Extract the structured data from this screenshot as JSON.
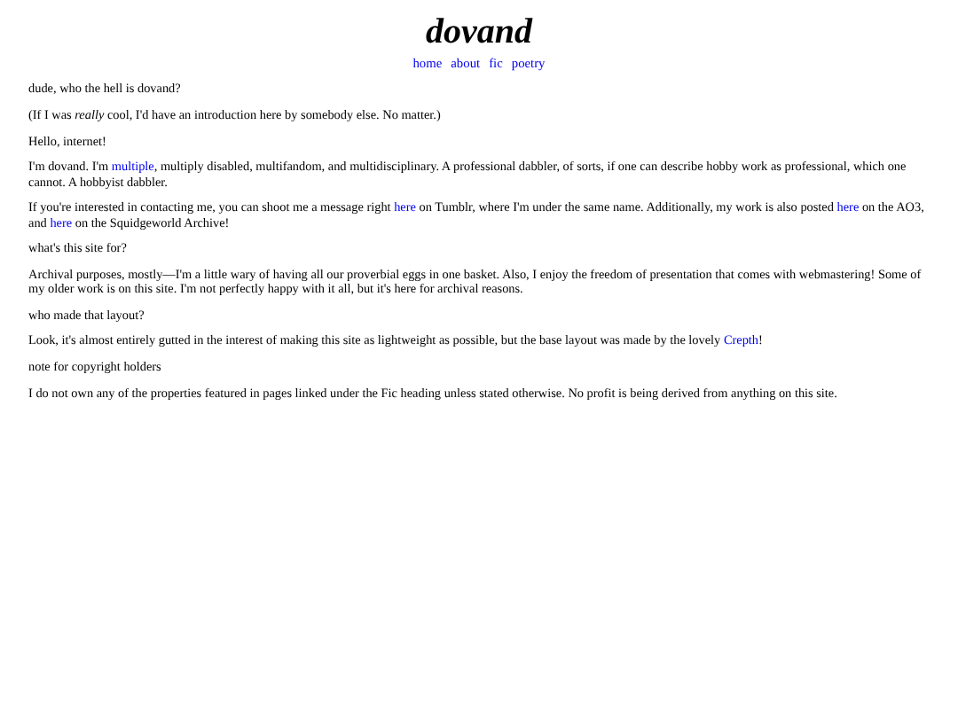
{
  "title": "dovand",
  "nav": [
    {
      "label": "home"
    },
    {
      "label": "about"
    },
    {
      "label": "fic"
    },
    {
      "label": "poetry"
    }
  ],
  "paragraphs": [
    {
      "parts": [
        {
          "kind": "text",
          "text": "dude, who the hell is dovand?"
        }
      ]
    },
    {
      "parts": [
        {
          "kind": "text",
          "text": "(If I was *really* cool, I'd have an introduction here by somebody else. No matter.)"
        }
      ]
    },
    {
      "parts": [
        {
          "kind": "text",
          "text": "Hello, internet!"
        }
      ]
    },
    {
      "parts": [
        {
          "kind": "text",
          "text": "I'm dovand. I'm "
        },
        {
          "kind": "link",
          "text": "multiple"
        },
        {
          "kind": "text",
          "text": ", multiply disabled, multifandom, and multidisciplinary. A professional dabbler, of sorts, if one can describe hobby work as professional, which one cannot. A hobbyist dabbler."
        }
      ]
    },
    {
      "parts": [
        {
          "kind": "text",
          "text": "If you're interested in contacting me, you can shoot me a message right "
        },
        {
          "kind": "link",
          "text": "here"
        },
        {
          "kind": "text",
          "text": " on Tumblr, where I'm under the same name. Additionally, my work is also posted "
        },
        {
          "kind": "link",
          "text": "here"
        },
        {
          "kind": "text",
          "text": " on the AO3, and "
        },
        {
          "kind": "link",
          "text": "here"
        },
        {
          "kind": "text",
          "text": " on the Squidgeworld Archive!"
        }
      ]
    },
    {
      "parts": [
        {
          "kind": "text",
          "text": "what's this site for?"
        }
      ]
    },
    {
      "parts": [
        {
          "kind": "text",
          "text": "Archival purposes, mostly—I'm a little wary of having all our proverbial eggs in one basket. Also, I enjoy the freedom of presentation that comes with webmastering! Some of my older work is on this site. I'm not perfectly happy with it all, but it's here for archival reasons."
        }
      ]
    },
    {
      "parts": [
        {
          "kind": "text",
          "text": "who made that layout?"
        }
      ]
    },
    {
      "parts": [
        {
          "kind": "text",
          "text": "Look, it's almost entirely gutted in the interest of making this site as lightweight as possible, but the base layout was made by the lovely "
        },
        {
          "kind": "link",
          "text": "Crepth"
        },
        {
          "kind": "text",
          "text": "!"
        }
      ]
    },
    {
      "parts": [
        {
          "kind": "text",
          "text": "note for copyright holders"
        }
      ]
    },
    {
      "parts": [
        {
          "kind": "text",
          "text": "I do not own any of the properties featured in pages linked under the Fic heading unless stated otherwise. No profit is being derived from anything on this site."
        }
      ]
    }
  ]
}
